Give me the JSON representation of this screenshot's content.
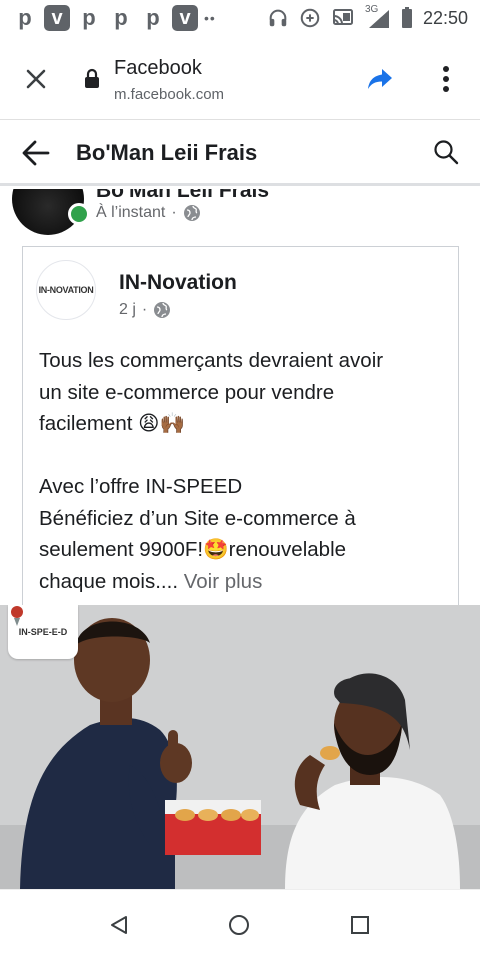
{
  "status_bar": {
    "time": "22:50",
    "network": "3G",
    "apps": [
      "p",
      "v",
      "p",
      "p",
      "p",
      "v"
    ]
  },
  "browser": {
    "title": "Facebook",
    "url": "m.facebook.com"
  },
  "page_header": {
    "title": "Bo'Man Leii Frais"
  },
  "outer_post": {
    "author": "Bo'Man Leii Frais",
    "time": "À l’instant",
    "separator": "·",
    "online": true
  },
  "shared_post": {
    "author": "IN-Novation",
    "time": "2 j",
    "separator": "·",
    "logo_text": "IN-NOVATION",
    "text_para1_lines": [
      "Tous les commerçants devraient avoir",
      "un site e-commerce pour vendre",
      "facilement 😩🙌🏾"
    ],
    "text_para2_lines": [
      "Avec l’offre IN-SPEED",
      "Bénéficiez d’un Site e-commerce à",
      "seulement 9900F!🤩renouvelable",
      "chaque mois...."
    ],
    "see_more": " Voir plus"
  },
  "media": {
    "logo_text": "IN-SPE-E-D"
  },
  "colors": {
    "online_green": "#31a24c",
    "share_blue": "#1a73e8",
    "meta_gray": "#65676b"
  }
}
